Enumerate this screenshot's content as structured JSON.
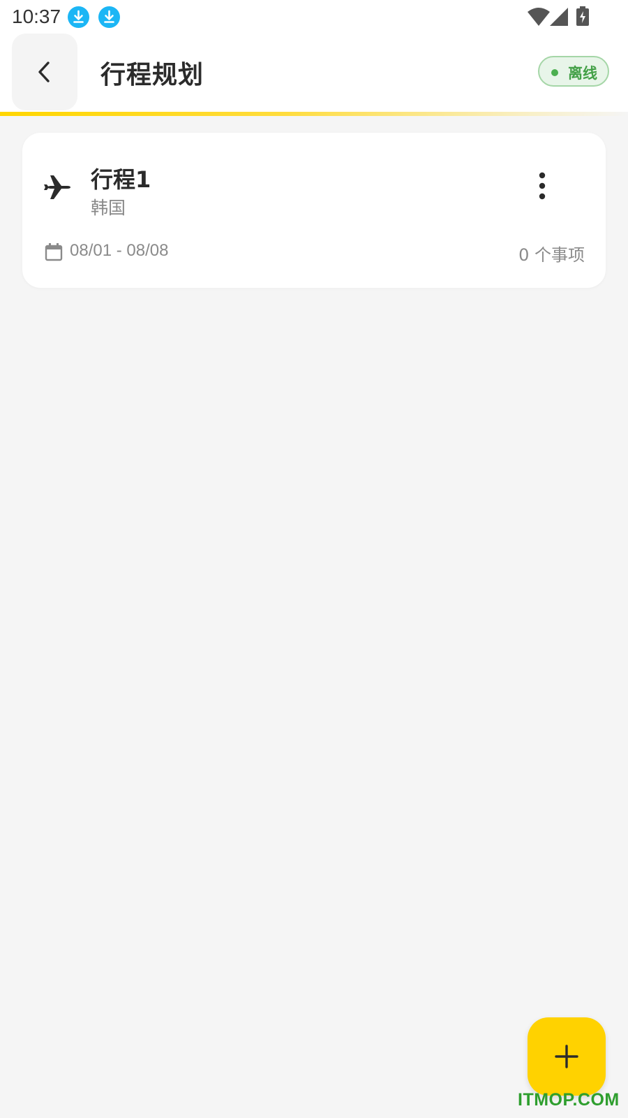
{
  "status_bar": {
    "time": "10:37",
    "notification_icons": [
      "download-icon",
      "download-icon"
    ],
    "system_icons": [
      "wifi-icon",
      "signal-icon",
      "battery-charging-icon"
    ]
  },
  "app_bar": {
    "back_icon": "chevron-left-icon",
    "title": "行程规划",
    "status_badge": "离线"
  },
  "trips": [
    {
      "icon": "✈",
      "name": "行程1",
      "destination": "韩国",
      "dates": "08/01 - 08/08",
      "items": "0 个事项",
      "menu_icon": "more-vertical-icon",
      "calendar_icon": "calendar-icon"
    }
  ],
  "fab": {
    "icon": "plus-icon"
  },
  "watermark": "ITMOP.COM",
  "colors": {
    "accent": "#ffd200",
    "background": "#f5f5f5",
    "card": "#ffffff",
    "offline_green": "#43a047",
    "download_blue": "#1cb6f5"
  }
}
